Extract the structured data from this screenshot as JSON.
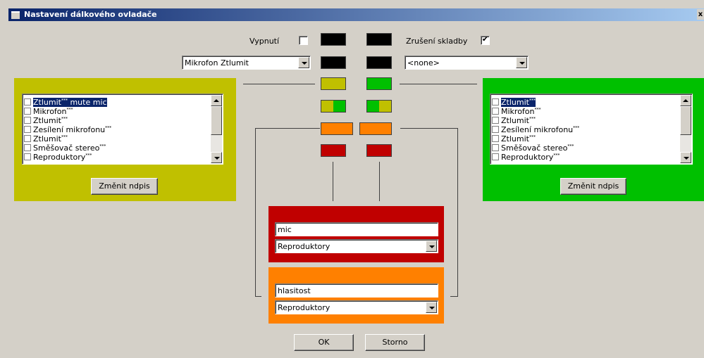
{
  "window": {
    "title": "Nastavení dálkového ovladače",
    "close_glyph": "x"
  },
  "top_controls": {
    "off_label": "Vypnutí",
    "off_checked": false,
    "skip_label": "Zrušení skladby",
    "skip_checked": true,
    "check_glyph": "✔",
    "left_combo_value": "Mikrofon Ztlumit",
    "right_combo_value": "<none>"
  },
  "colors": {
    "black": "#000000",
    "olive": "#c0c000",
    "green": "#00c000",
    "orange": "#ff8000",
    "red": "#c00000"
  },
  "left_panel": {
    "items": [
      {
        "label": "Ztlumit",
        "sup": "***",
        "suffix": " mute mic",
        "selected": true
      },
      {
        "label": "Mikrofon",
        "sup": "***",
        "suffix": "",
        "selected": false
      },
      {
        "label": "Ztlumit",
        "sup": "***",
        "suffix": "",
        "selected": false
      },
      {
        "label": "Zesílení mikrofonu",
        "sup": "***",
        "suffix": "",
        "selected": false
      },
      {
        "label": "Ztlumit",
        "sup": "***",
        "suffix": "",
        "selected": false
      },
      {
        "label": "Směšovač stereo",
        "sup": "***",
        "suffix": "",
        "selected": false
      },
      {
        "label": "Reproduktory",
        "sup": "***",
        "suffix": "",
        "selected": false
      }
    ],
    "button_label": "Změnit ndpis"
  },
  "right_panel": {
    "items": [
      {
        "label": "Ztlumit",
        "sup": "***",
        "suffix": "",
        "selected": true
      },
      {
        "label": "Mikrofon",
        "sup": "***",
        "suffix": "",
        "selected": false
      },
      {
        "label": "Ztlumit",
        "sup": "***",
        "suffix": "",
        "selected": false
      },
      {
        "label": "Zesílení mikrofonu",
        "sup": "***",
        "suffix": "",
        "selected": false
      },
      {
        "label": "Ztlumit",
        "sup": "***",
        "suffix": "",
        "selected": false
      },
      {
        "label": "Směšovač stereo",
        "sup": "***",
        "suffix": "",
        "selected": false
      },
      {
        "label": "Reproduktory",
        "sup": "***",
        "suffix": "",
        "selected": false
      }
    ],
    "button_label": "Změnit ndpis"
  },
  "red_panel": {
    "name_value": "mic",
    "device_value": "Reproduktory"
  },
  "orange_panel": {
    "name_value": "hlasitost",
    "device_value": "Reproduktory"
  },
  "footer": {
    "ok_label": "OK",
    "cancel_label": "Storno"
  }
}
